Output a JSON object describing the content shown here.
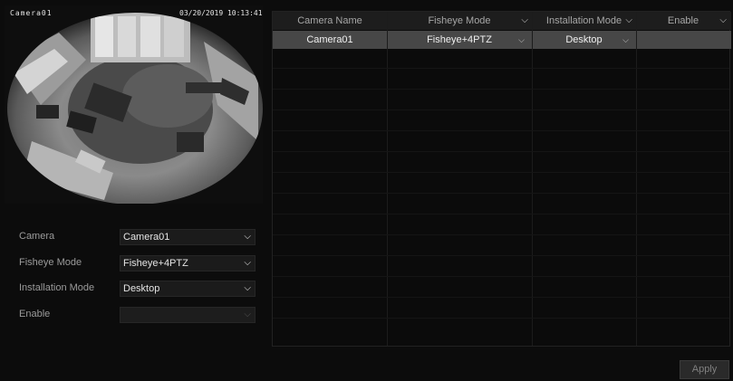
{
  "preview": {
    "osd_camera": "Camera01",
    "osd_datetime": "03/20/2019 10:13:41"
  },
  "form": {
    "camera": {
      "label": "Camera",
      "value": "Camera01"
    },
    "fisheye_mode": {
      "label": "Fisheye Mode",
      "value": "Fisheye+4PTZ"
    },
    "installation_mode": {
      "label": "Installation Mode",
      "value": "Desktop"
    },
    "enable": {
      "label": "Enable",
      "value": ""
    }
  },
  "table": {
    "columns": [
      "Camera Name",
      "Fisheye Mode",
      "Installation Mode",
      "Enable"
    ],
    "rows": [
      {
        "camera_name": "Camera01",
        "fisheye_mode": "Fisheye+4PTZ",
        "installation_mode": "Desktop",
        "enable": ""
      }
    ]
  },
  "apply_label": "Apply",
  "icons": {
    "dropdown": "chevron-down-icon"
  }
}
